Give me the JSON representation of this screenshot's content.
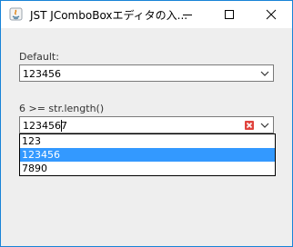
{
  "window": {
    "title": "JST JComboBoxエディタの入...",
    "icon": "java-app-icon",
    "controls": {
      "minimize": "minimize-icon",
      "maximize": "maximize-icon",
      "close": "close-icon"
    }
  },
  "default_section": {
    "label": "Default:",
    "combo_value": "123456"
  },
  "limited_section": {
    "label": "6 >= str.length()",
    "combo_value": "1234567",
    "error_icon": "clear-icon"
  },
  "popup": {
    "items": [
      "123",
      "123456",
      "7890"
    ],
    "selected_index": 1
  },
  "colors": {
    "selection": "#3399ff",
    "error": "#e0443e",
    "window_border": "#1883d7"
  }
}
